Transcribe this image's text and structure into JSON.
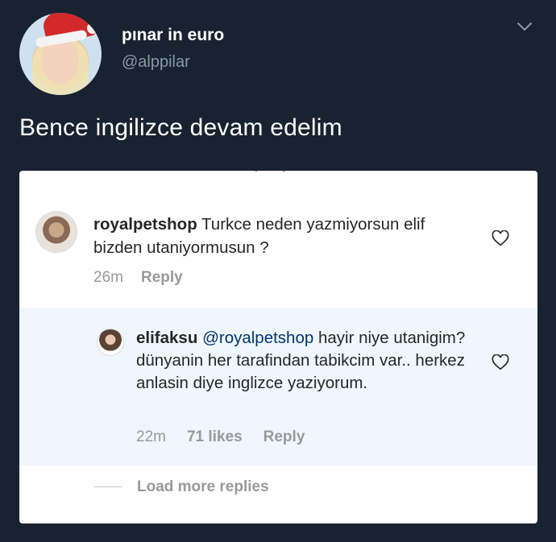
{
  "tweet": {
    "display_name": "pınar in euro",
    "handle": "@alppilar",
    "text": "Bence ingilizce devam edelim",
    "menu_icon": "chevron-down-icon"
  },
  "embedded_screenshot": {
    "comments": [
      {
        "username": "royalpetshop",
        "text": " Turkce neden yazmiyorsun elif bizden utaniyormusun ?",
        "time": "26m",
        "reply_label": "Reply",
        "like_icon": "heart-outline-icon"
      }
    ],
    "reply": {
      "username": "elifaksu",
      "mention": "@royalpetshop",
      "text": " hayir niye utanigim? dünyanin her tarafindan tabikcim var.. herkez anlasin diye inglizce yaziyorum.",
      "time": "22m",
      "likes": "71 likes",
      "reply_label": "Reply",
      "like_icon": "heart-outline-icon"
    },
    "load_more_label": "Load more replies"
  },
  "colors": {
    "background": "#182230",
    "card": "#ffffff",
    "reply_highlight": "#eff6fd",
    "muted": "#999999",
    "handle": "#8899a6",
    "mention": "#003569"
  }
}
